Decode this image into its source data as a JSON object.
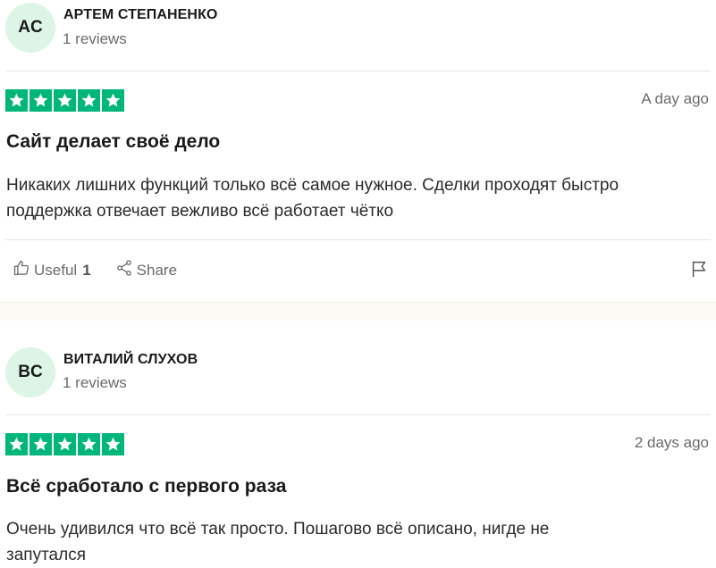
{
  "reviews": [
    {
      "initials": "AC",
      "name": "АРТЕМ СТЕПАНЕНКО",
      "reviews_count": "1 reviews",
      "rating": 5,
      "date": "A day ago",
      "title": "Сайт делает своё дело",
      "body_lines": [
        "Никаких лишних функций только всё самое нужное. Сделки проходят быстро",
        "поддержка отвечает вежливо всё работает чётко"
      ],
      "useful_label": "Useful",
      "useful_count": "1",
      "share_label": "Share"
    },
    {
      "initials": "BC",
      "name": "ВИТАЛИЙ СЛУХОВ",
      "reviews_count": "1 reviews",
      "rating": 5,
      "date": "2 days ago",
      "title": "Всё сработало с первого раза",
      "body_lines": [
        "Очень удивился что всё так просто. Пошагово всё описано, нигде не",
        "запутался"
      ]
    }
  ],
  "colors": {
    "star_bg": "#00b67a",
    "avatar_bg": "#dcf5e6",
    "muted_text": "#6b6b6b"
  },
  "icons": [
    "star-icon",
    "thumbs-up-icon",
    "share-icon",
    "flag-icon"
  ]
}
